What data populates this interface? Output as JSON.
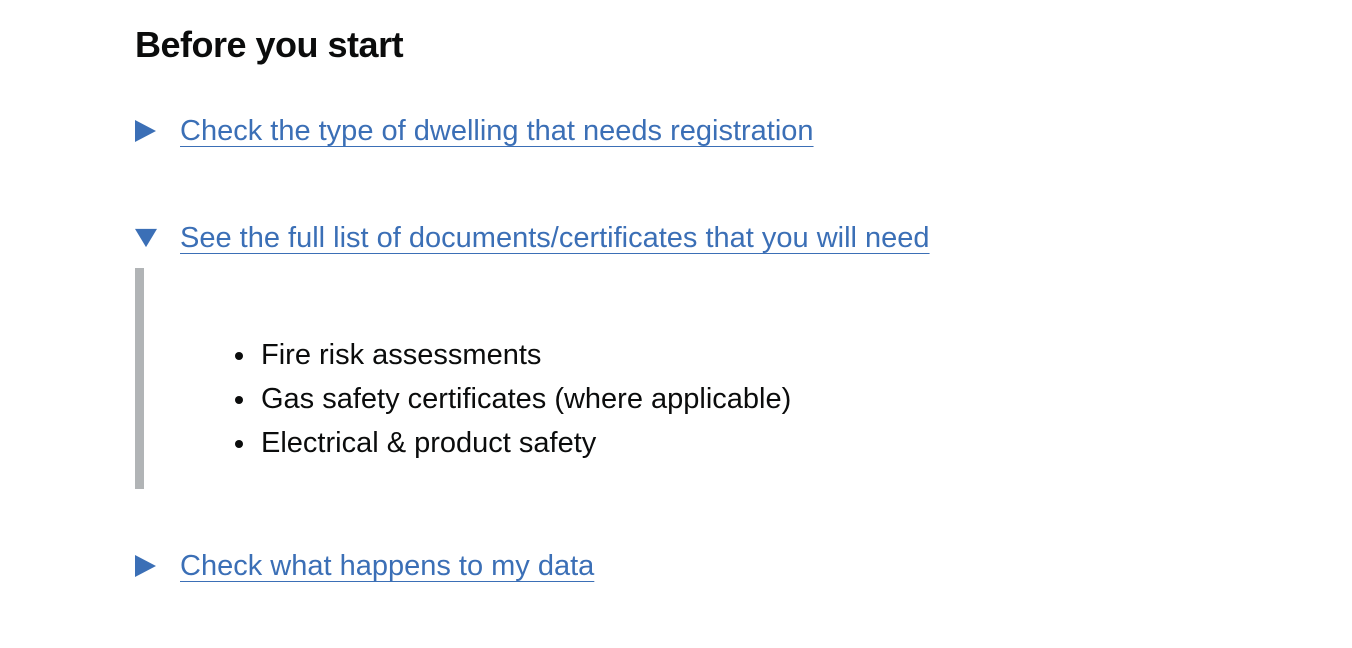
{
  "page": {
    "heading": "Before you start"
  },
  "details": [
    {
      "summary": "Check the type of dwelling that needs registration",
      "expanded": false,
      "arrow_icon": "triangle-right-icon"
    },
    {
      "summary": "See the full list of documents/certificates that you will need",
      "expanded": true,
      "arrow_icon": "triangle-down-icon",
      "items": [
        "Fire risk assessments",
        "Gas safety certificates (where applicable)",
        "Electrical & product safety"
      ]
    },
    {
      "summary": "Check what happens to my data",
      "expanded": false,
      "arrow_icon": "triangle-right-icon"
    }
  ],
  "colors": {
    "link": "#3b6fb6",
    "text": "#0b0c0c",
    "border": "#b1b4b6"
  }
}
